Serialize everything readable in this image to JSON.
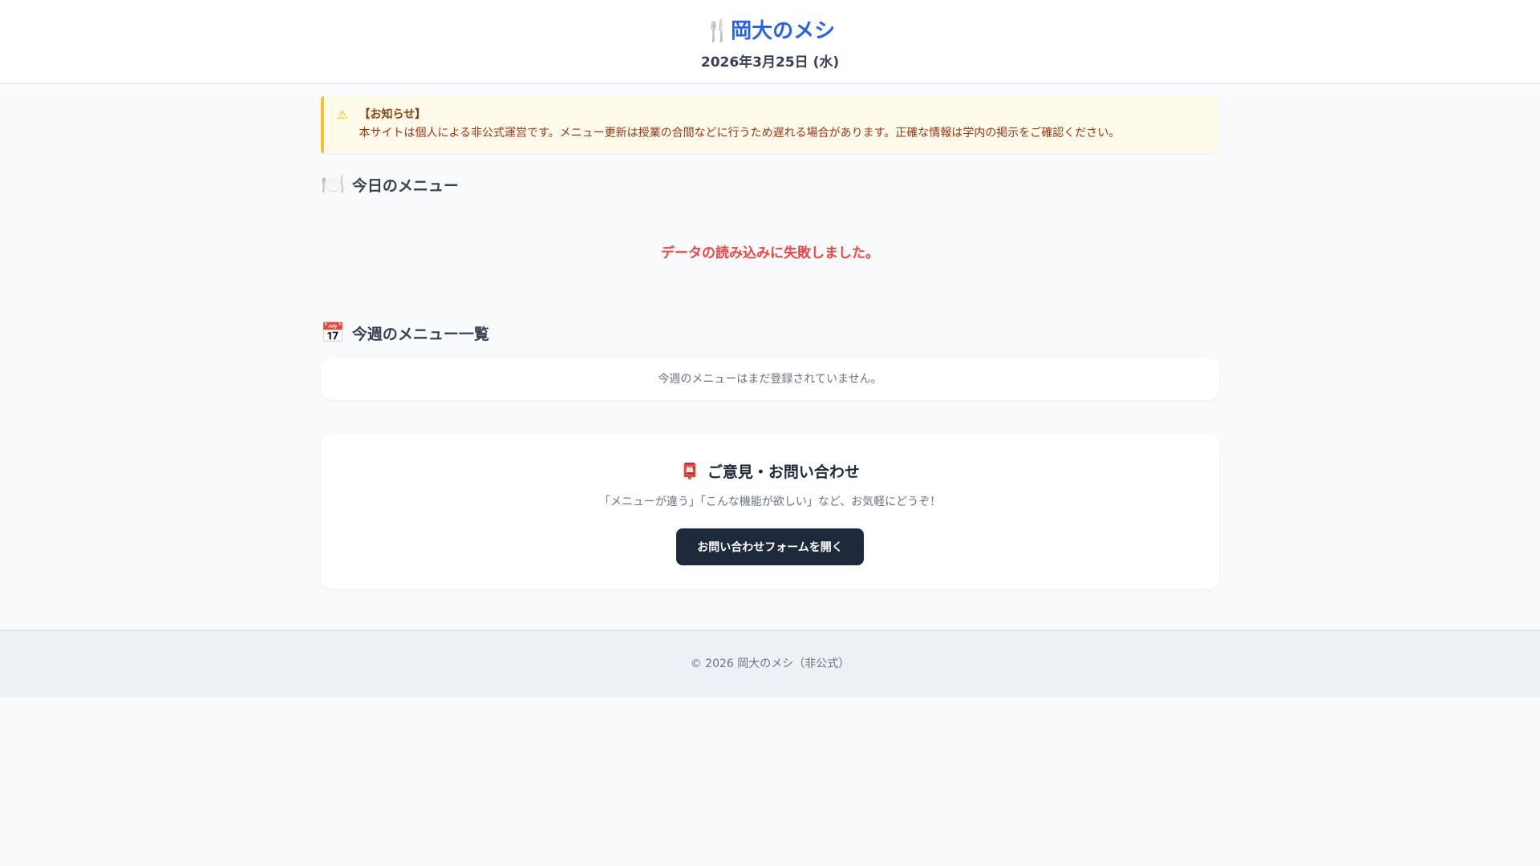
{
  "header": {
    "title": "岡大のメシ",
    "title_icon": "🍴",
    "date": "2026年3月25日 (水)"
  },
  "notice": {
    "icon": "⚠",
    "title": "【お知らせ】",
    "body": "本サイトは個人による非公式運営です。メニュー更新は授業の合間などに行うため遅れる場合があります。正確な情報は学内の掲示をご確認ください。"
  },
  "today": {
    "icon": "🍽️",
    "heading": "今日のメニュー",
    "error": "データの読み込みに失敗しました。"
  },
  "week": {
    "icon": "📅",
    "heading": "今週のメニュー一覧",
    "empty": "今週のメニューはまだ登録されていません。"
  },
  "contact": {
    "icon": "📮",
    "heading": "ご意見・お問い合わせ",
    "text": "「メニューが違う」「こんな機能が欲しい」など、お気軽にどうぞ！",
    "button": "お問い合わせフォームを開く"
  },
  "footer": {
    "text": "© 2026 岡大のメシ（非公式）"
  }
}
